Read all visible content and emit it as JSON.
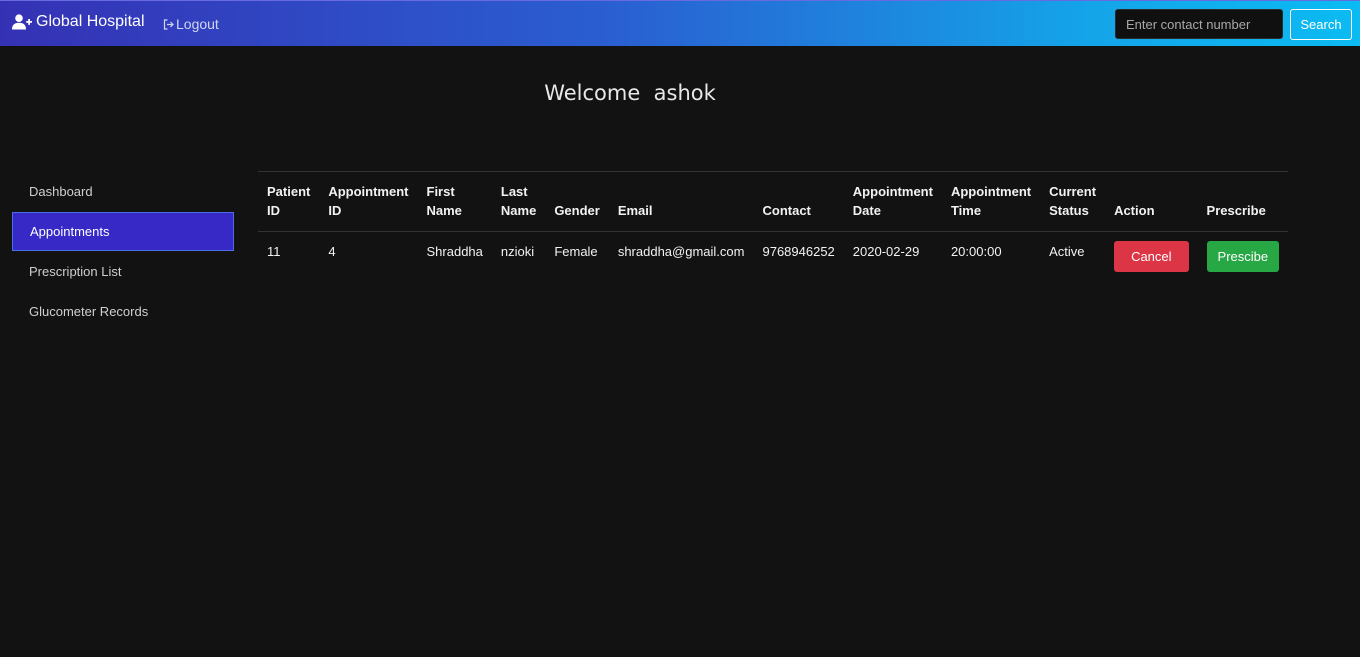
{
  "navbar": {
    "brand": "Global Hospital",
    "brand_icon": "user-plus-icon",
    "logout_label": "Logout",
    "logout_icon": "sign-out-icon",
    "search_placeholder": "Enter contact number",
    "search_button": "Search"
  },
  "welcome": {
    "text": "Welcome  ashok"
  },
  "sidebar": {
    "items": [
      {
        "label": "Dashboard",
        "active": false
      },
      {
        "label": "Appointments",
        "active": true
      },
      {
        "label": "Prescription List",
        "active": false
      },
      {
        "label": "Glucometer Records",
        "active": false
      }
    ]
  },
  "table": {
    "headers": {
      "patient_id": [
        "Patient",
        "ID"
      ],
      "appointment_id": [
        "Appointment",
        "ID"
      ],
      "first_name": [
        "First",
        "Name"
      ],
      "last_name": [
        "Last",
        "Name"
      ],
      "gender": "Gender",
      "email": "Email",
      "contact": "Contact",
      "appointment_date": [
        "Appointment",
        "Date"
      ],
      "appointment_time": [
        "Appointment",
        "Time"
      ],
      "current_status": [
        "Current",
        "Status"
      ],
      "action": "Action",
      "prescribe": "Prescribe"
    },
    "rows": [
      {
        "patient_id": "11",
        "appointment_id": "4",
        "first_name": "Shraddha",
        "last_name": "nzioki",
        "gender": "Female",
        "email": "shraddha@gmail.com",
        "contact": "9768946252",
        "appointment_date": "2020-02-29",
        "appointment_time": "20:00:00",
        "current_status": "Active",
        "action_label": "Cancel",
        "prescribe_label": "Prescibe"
      }
    ]
  },
  "colors": {
    "navbar_start": "#3531b5",
    "navbar_end": "#0bbbf2",
    "background": "#121212",
    "sidebar_active": "#3629c6",
    "cancel": "#dc3545",
    "prescribe": "#28a745"
  }
}
